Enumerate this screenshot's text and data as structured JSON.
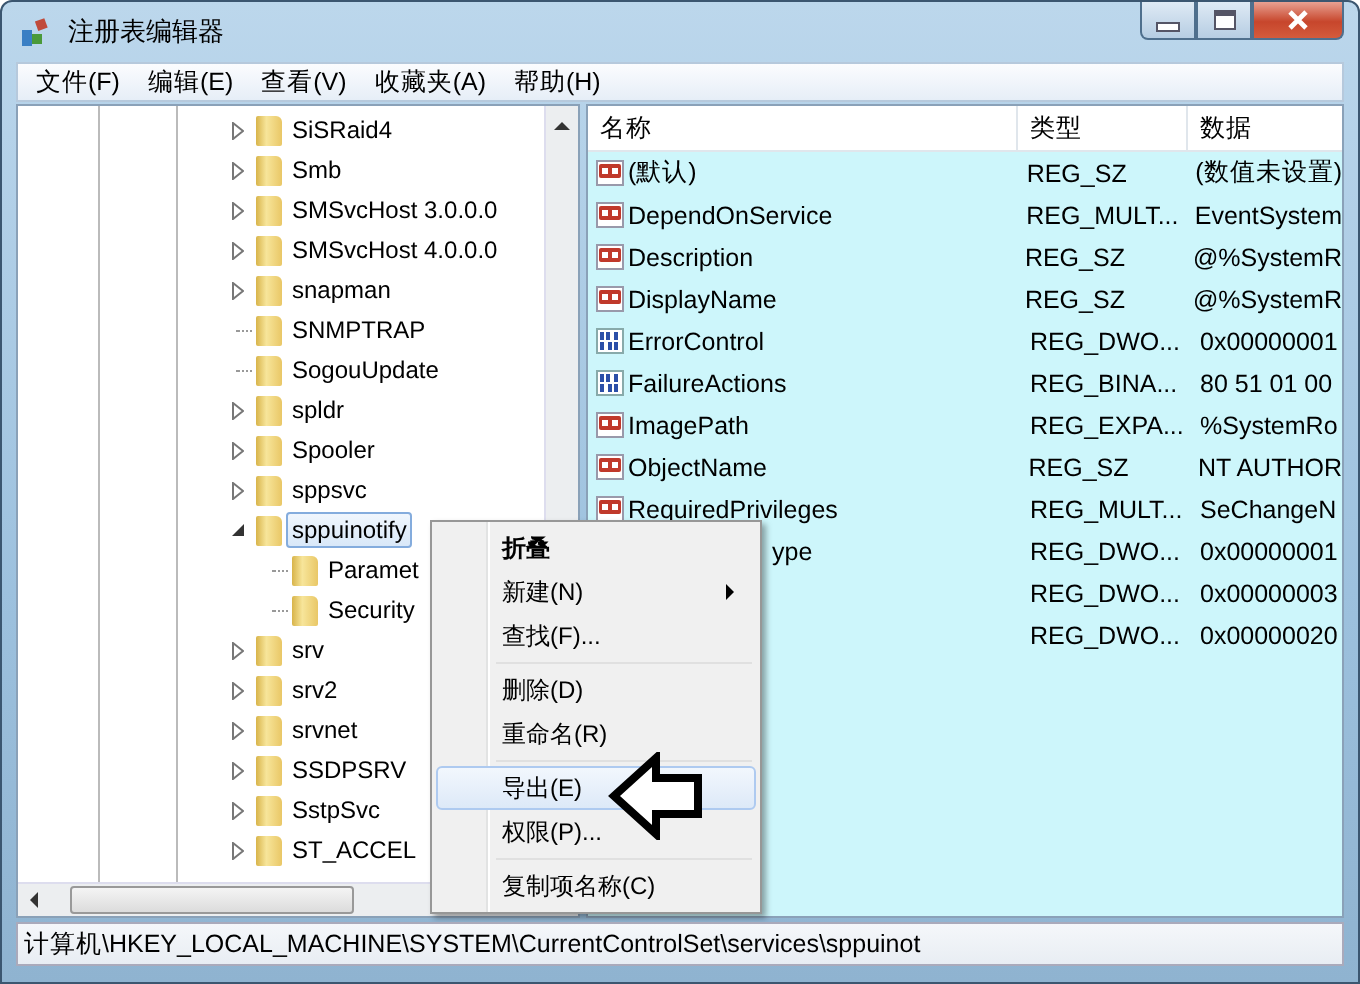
{
  "window": {
    "title": "注册表编辑器"
  },
  "menu_bar": [
    "文件(F)",
    "编辑(E)",
    "查看(V)",
    "收藏夹(A)",
    "帮助(H)"
  ],
  "tree": [
    {
      "label": "SiSRaid4",
      "kind": "collapsed",
      "selected": false
    },
    {
      "label": "Smb",
      "kind": "collapsed",
      "selected": false
    },
    {
      "label": "SMSvcHost 3.0.0.0",
      "kind": "collapsed",
      "selected": false
    },
    {
      "label": "SMSvcHost 4.0.0.0",
      "kind": "collapsed",
      "selected": false
    },
    {
      "label": "snapman",
      "kind": "collapsed",
      "selected": false
    },
    {
      "label": "SNMPTRAP",
      "kind": "leaf",
      "selected": false
    },
    {
      "label": "SogouUpdate",
      "kind": "leaf",
      "selected": false
    },
    {
      "label": "spldr",
      "kind": "collapsed",
      "selected": false
    },
    {
      "label": "Spooler",
      "kind": "collapsed",
      "selected": false
    },
    {
      "label": "sppsvc",
      "kind": "collapsed",
      "selected": false
    },
    {
      "label": "sppuinotify",
      "kind": "expanded",
      "selected": true,
      "children": [
        {
          "label": "Paramet",
          "kind": "leaf",
          "selected": false
        },
        {
          "label": "Security",
          "kind": "leaf",
          "selected": false
        }
      ]
    },
    {
      "label": "srv",
      "kind": "collapsed",
      "selected": false
    },
    {
      "label": "srv2",
      "kind": "collapsed",
      "selected": false
    },
    {
      "label": "srvnet",
      "kind": "collapsed",
      "selected": false
    },
    {
      "label": "SSDPSRV",
      "kind": "collapsed",
      "selected": false
    },
    {
      "label": "SstpSvc",
      "kind": "collapsed",
      "selected": false
    },
    {
      "label": "ST_ACCEL",
      "kind": "collapsed",
      "selected": false
    }
  ],
  "values": {
    "columns": [
      "名称",
      "类型",
      "数据"
    ],
    "rows": [
      {
        "kind": "string",
        "name": "(默认)",
        "type": "REG_SZ",
        "data": "(数值未设置)"
      },
      {
        "kind": "string",
        "name": "DependOnService",
        "type": "REG_MULT...",
        "data": "EventSystem"
      },
      {
        "kind": "string",
        "name": "Description",
        "type": "REG_SZ",
        "data": "@%SystemR"
      },
      {
        "kind": "string",
        "name": "DisplayName",
        "type": "REG_SZ",
        "data": "@%SystemR"
      },
      {
        "kind": "binary",
        "name": "ErrorControl",
        "type": "REG_DWO...",
        "data": "0x00000001"
      },
      {
        "kind": "binary",
        "name": "FailureActions",
        "type": "REG_BINA...",
        "data": "80 51 01 00"
      },
      {
        "kind": "string",
        "name": "ImagePath",
        "type": "REG_EXPA...",
        "data": "%SystemRo"
      },
      {
        "kind": "string",
        "name": "ObjectName",
        "type": "REG_SZ",
        "data": "NT AUTHOR"
      },
      {
        "kind": "string",
        "name": "RequiredPrivileges",
        "type": "REG_MULT...",
        "data": "SeChangeN"
      },
      {
        "kind": "partial",
        "name": "ype",
        "type": "REG_DWO...",
        "data": "0x00000001"
      },
      {
        "kind": "hidden",
        "type": "REG_DWO...",
        "data": "0x00000003"
      },
      {
        "kind": "hidden",
        "type": "REG_DWO...",
        "data": "0x00000020"
      }
    ]
  },
  "context_menu": [
    {
      "label": "折叠",
      "kind": "default",
      "selected": false
    },
    {
      "label": "新建(N)",
      "kind": "submenu",
      "selected": false
    },
    {
      "label": "查找(F)...",
      "kind": "item",
      "selected": false
    },
    {
      "kind": "separator"
    },
    {
      "label": "删除(D)",
      "kind": "item",
      "selected": false
    },
    {
      "label": "重命名(R)",
      "kind": "item",
      "selected": false
    },
    {
      "kind": "separator"
    },
    {
      "label": "导出(E)",
      "kind": "item",
      "selected": true
    },
    {
      "label": "权限(P)...",
      "kind": "item",
      "selected": false
    },
    {
      "kind": "separator"
    },
    {
      "label": "复制项名称(C)",
      "kind": "item",
      "selected": false
    }
  ],
  "status_bar": "计算机\\HKEY_LOCAL_MACHINE\\SYSTEM\\CurrentControlSet\\services\\sppuinot"
}
